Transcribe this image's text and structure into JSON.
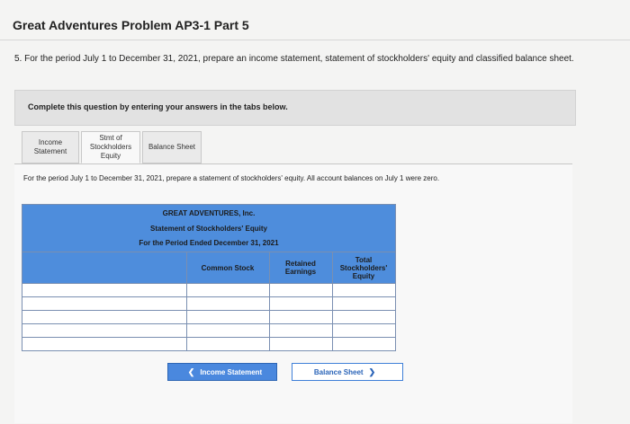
{
  "header": {
    "title": "Great Adventures Problem AP3-1 Part 5"
  },
  "question": {
    "text": "5. For the period July 1 to December 31, 2021, prepare an income statement, statement of stockholders' equity and classified balance sheet."
  },
  "instruction": {
    "text": "Complete this question by entering your answers in the tabs below."
  },
  "tabs": [
    {
      "label_line1": "Income",
      "label_line2": "Statement"
    },
    {
      "label_line1": "Stmt of",
      "label_line2": "Stockholders",
      "label_line3": "Equity"
    },
    {
      "label_line1": "Balance Sheet"
    }
  ],
  "panel": {
    "text": "For the period July 1 to December 31, 2021, prepare a statement of stockholders' equity. All account balances on July 1 were zero."
  },
  "statement": {
    "company": "GREAT ADVENTURES, Inc.",
    "name": "Statement of Stockholders' Equity",
    "period": "For the Period Ended December 31, 2021",
    "columns": {
      "common_stock": "Common Stock",
      "retained_earnings_1": "Retained",
      "retained_earnings_2": "Earnings",
      "total_1": "Total",
      "total_2": "Stockholders'",
      "total_3": "Equity"
    },
    "rows": [
      {
        "label": "",
        "common_stock": "",
        "retained_earnings": "",
        "total": ""
      },
      {
        "label": "",
        "common_stock": "",
        "retained_earnings": "",
        "total": ""
      },
      {
        "label": "",
        "common_stock": "",
        "retained_earnings": "",
        "total": ""
      },
      {
        "label": "",
        "common_stock": "",
        "retained_earnings": "",
        "total": ""
      },
      {
        "label": "",
        "common_stock": "",
        "retained_earnings": "",
        "total": ""
      }
    ]
  },
  "navigation": {
    "prev_label": "Income Statement",
    "next_label": "Balance Sheet",
    "prev_icon": "chevron-left-icon",
    "next_icon": "chevron-right-icon"
  },
  "colors": {
    "table_header": "#4e8ddc",
    "button": "#3f7fd8"
  }
}
